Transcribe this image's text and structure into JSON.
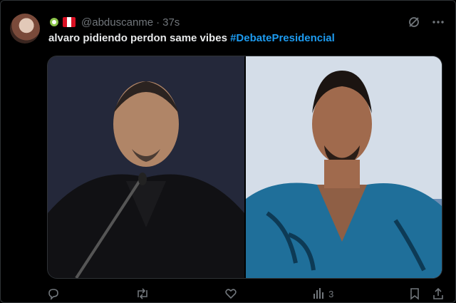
{
  "tweet": {
    "handle": "@abduscanme",
    "separator": "·",
    "time": "37s",
    "text": "alvaro pidiendo perdon same vibes",
    "hashtag": "#DebatePresidencial",
    "icons": [
      "badge-icon",
      "peru-flag-icon",
      "grok-icon",
      "more-icon"
    ]
  },
  "actions": {
    "views_count": "3",
    "icons": [
      "reply-icon",
      "retweet-icon",
      "like-icon",
      "views-icon",
      "bookmark-icon",
      "share-icon"
    ]
  },
  "colors": {
    "background": "#000000",
    "text": "#e7e9ea",
    "muted": "#71767b",
    "link": "#1d9bf0"
  }
}
